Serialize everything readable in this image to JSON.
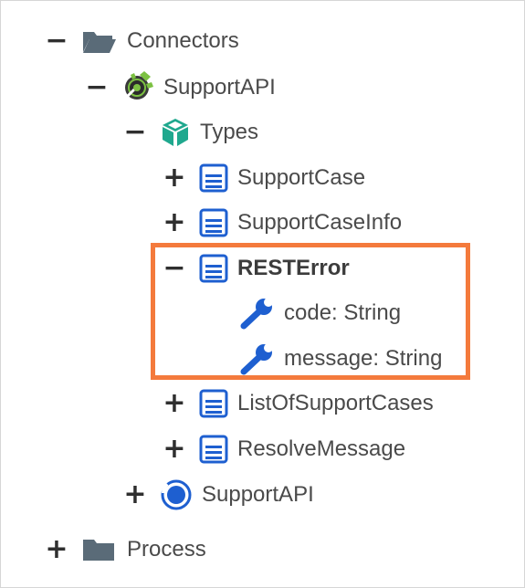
{
  "tree": {
    "connectors": {
      "label": "Connectors",
      "toggle": "−",
      "icon": "folder-open-icon"
    },
    "supportapi_connector": {
      "label": "SupportAPI",
      "toggle": "−",
      "icon": "connector-icon"
    },
    "types": {
      "label": "Types",
      "toggle": "−",
      "icon": "cube-icon"
    },
    "support_case": {
      "label": "SupportCase",
      "toggle": "+",
      "icon": "type-icon"
    },
    "support_case_info": {
      "label": "SupportCaseInfo",
      "toggle": "+",
      "icon": "type-icon"
    },
    "rest_error": {
      "label": "RESTError",
      "toggle": "−",
      "icon": "type-icon"
    },
    "code_field": {
      "label": "code: String",
      "icon": "wrench-icon"
    },
    "message_field": {
      "label": "message: String",
      "icon": "wrench-icon"
    },
    "list_of_support_cases": {
      "label": "ListOfSupportCases",
      "toggle": "+",
      "icon": "type-icon"
    },
    "resolve_message": {
      "label": "ResolveMessage",
      "toggle": "+",
      "icon": "type-icon"
    },
    "supportapi_service": {
      "label": "SupportAPI",
      "toggle": "+",
      "icon": "service-icon"
    },
    "process": {
      "label": "Process",
      "toggle": "+",
      "icon": "folder-icon"
    }
  },
  "colors": {
    "highlight_border": "#f47a3c",
    "type_icon_blue": "#1e5fd0",
    "cube_green": "#1fa88e",
    "folder_gray": "#5a6b78"
  }
}
